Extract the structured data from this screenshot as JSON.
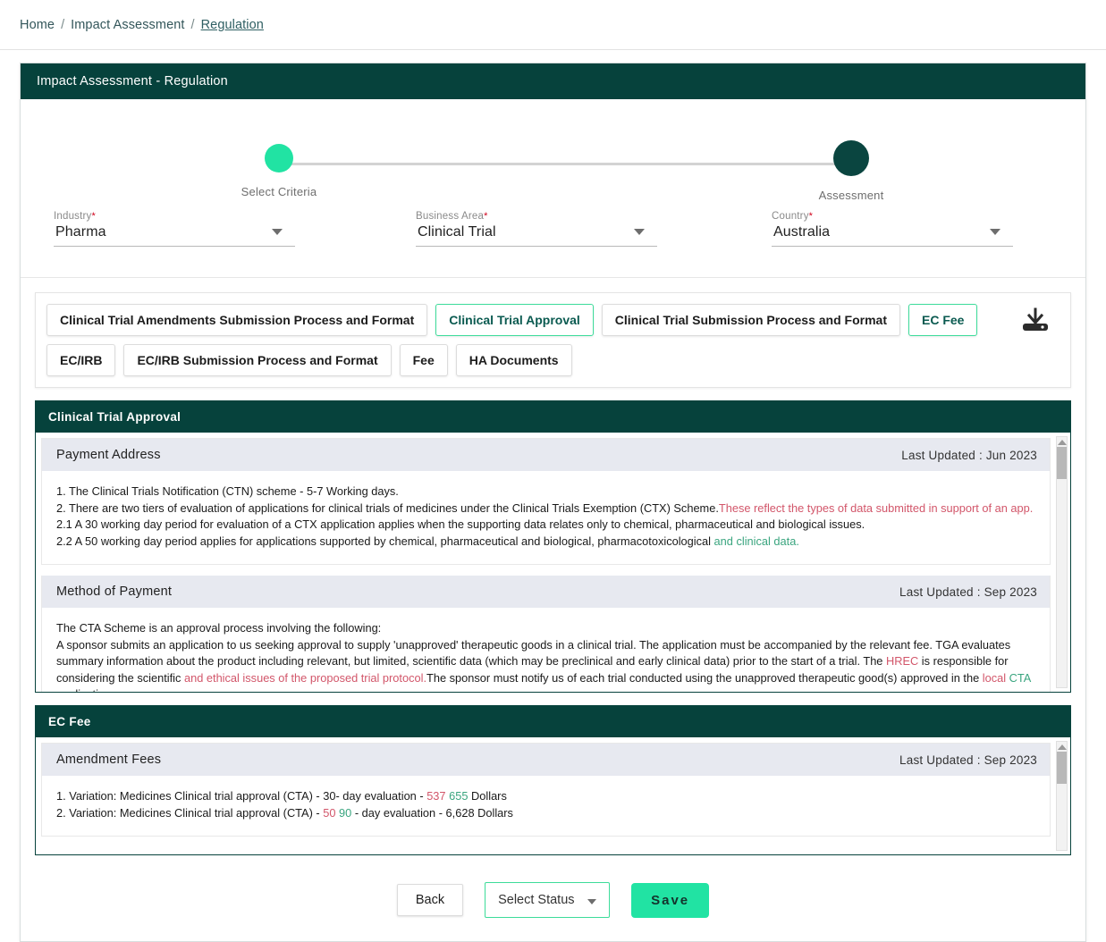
{
  "breadcrumb": {
    "items": [
      {
        "label": "Home",
        "active": false
      },
      {
        "label": "Impact Assessment",
        "active": false
      },
      {
        "label": "Regulation",
        "active": true
      }
    ],
    "separator": "/"
  },
  "card": {
    "title": "Impact Assessment - Regulation"
  },
  "stepper": {
    "steps": [
      {
        "label": "Select Criteria",
        "state": "done"
      },
      {
        "label": "Assessment",
        "state": "current"
      }
    ]
  },
  "filters": [
    {
      "label": "Industry",
      "required": "*",
      "value": "Pharma"
    },
    {
      "label": "Business Area",
      "required": "*",
      "value": "Clinical Trial"
    },
    {
      "label": "Country",
      "required": "*",
      "value": "Australia"
    }
  ],
  "chips": [
    {
      "label": "Clinical Trial Amendments Submission Process and Format",
      "selected": false
    },
    {
      "label": "Clinical Trial Approval",
      "selected": true
    },
    {
      "label": "Clinical Trial Submission Process and Format",
      "selected": false
    },
    {
      "label": "EC Fee",
      "selected": true
    },
    {
      "label": "EC/IRB",
      "selected": false
    },
    {
      "label": "EC/IRB Submission Process and Format",
      "selected": false
    },
    {
      "label": "Fee",
      "selected": false
    },
    {
      "label": "HA Documents",
      "selected": false
    }
  ],
  "download_icon": "download-icon",
  "panels": [
    {
      "title": "Clinical Trial Approval",
      "sections": [
        {
          "title": "Payment Address",
          "updated_label": "Last Updated :",
          "updated_value": "Jun 2023",
          "lines": [
            [
              {
                "t": "1. The Clinical Trials Notification (CTN) scheme - 5-7 Working days.",
                "c": "plain"
              }
            ],
            [
              {
                "t": "2. There are two tiers of evaluation of applications for clinical trials of medicines under the Clinical Trials Exemption (CTX) Scheme.",
                "c": "plain"
              },
              {
                "t": "These reflect the types of data submitted in support of an app.",
                "c": "red"
              }
            ],
            [
              {
                "t": "2.1 A 30 working day period for evaluation of a CTX application applies when the supporting data relates only to chemical, pharmaceutical and biological issues.",
                "c": "plain"
              }
            ],
            [
              {
                "t": "2.2 A 50 working day period applies for applications supported by chemical, pharmaceutical and biological, pharmacotoxicological ",
                "c": "plain"
              },
              {
                "t": "and clinical data.",
                "c": "green"
              }
            ]
          ]
        },
        {
          "title": "Method of Payment",
          "updated_label": "Last Updated :",
          "updated_value": "Sep 2023",
          "lines": [
            [
              {
                "t": "The CTA Scheme is an approval process involving the following:",
                "c": "plain"
              }
            ],
            [
              {
                "t": "A sponsor submits an application to us seeking approval to supply 'unapproved' therapeutic goods in a clinical trial. The application must be accompanied by the relevant fee. TGA evaluates summary information about the product including relevant, but limited, scientific data (which may be preclinical and early clinical data) prior to the start of a trial. The ",
                "c": "plain"
              },
              {
                "t": "HREC",
                "c": "red"
              },
              {
                "t": "  is responsible for considering the scientific ",
                "c": "plain"
              },
              {
                "t": "and ethical issues of the proposed trial protocol.",
                "c": "red"
              },
              {
                "t": "The sponsor must notify us of each trial conducted using the unapproved therapeutic good(s) approved in the ",
                "c": "plain"
              },
              {
                "t": "local",
                "c": "red"
              },
              {
                "t": " CTA",
                "c": "green"
              },
              {
                "t": " application.",
                "c": "plain"
              }
            ]
          ]
        }
      ]
    },
    {
      "title": "EC Fee",
      "sections": [
        {
          "title": "Amendment Fees",
          "updated_label": "Last Updated :",
          "updated_value": "Sep 2023",
          "lines": [
            [
              {
                "t": "1. Variation: Medicines Clinical trial approval (CTA) - 30- day evaluation - ",
                "c": "plain"
              },
              {
                "t": "537",
                "c": "red"
              },
              {
                "t": " 655",
                "c": "green"
              },
              {
                "t": " Dollars",
                "c": "plain"
              }
            ],
            [
              {
                "t": "2. Variation: Medicines Clinical trial approval (CTA) - ",
                "c": "plain"
              },
              {
                "t": "50",
                "c": "red"
              },
              {
                "t": " 90",
                "c": "green"
              },
              {
                "t": " - day evaluation - 6,628 Dollars",
                "c": "plain"
              }
            ]
          ]
        }
      ]
    }
  ],
  "actions": {
    "back_label": "Back",
    "status_value": "Select Status",
    "save_label": "Save"
  },
  "colors": {
    "brand_dark": "#06423c",
    "accent_green": "#21e3a3",
    "red_text": "#d2566a",
    "green_text": "#3aa57f",
    "section_head_bg": "#e7e9f0"
  }
}
